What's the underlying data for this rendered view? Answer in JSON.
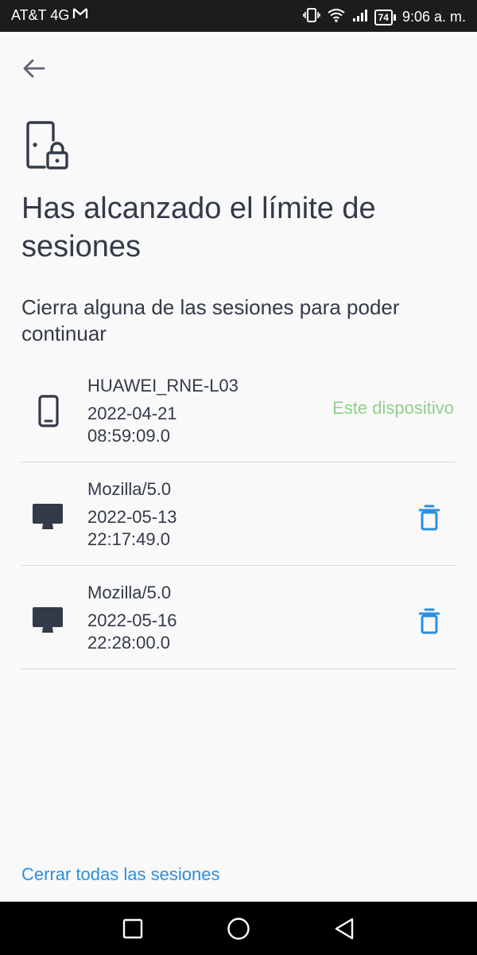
{
  "status_bar": {
    "carrier": "AT&T 4G",
    "battery": "74",
    "time": "9:06 a. m."
  },
  "header": {
    "title": "Has alcanzado el límite de sesiones",
    "subtitle": "Cierra alguna de las sesiones para poder continuar"
  },
  "sessions": [
    {
      "device": "HUAWEI_RNE-L03",
      "date": "2022-04-21",
      "time": "08:59:09.0",
      "type": "phone-icon",
      "current_label": "Este dispositivo"
    },
    {
      "device": "Mozilla/5.0",
      "date": "2022-05-13",
      "time": "22:17:49.0",
      "type": "desktop-icon"
    },
    {
      "device": "Mozilla/5.0",
      "date": "2022-05-16",
      "time": "22:28:00.0",
      "type": "desktop-icon"
    }
  ],
  "footer": {
    "close_all": "Cerrar todas las sesiones"
  },
  "colors": {
    "text": "#333a48",
    "current_device": "#8fd08a",
    "accent": "#2b8fdc"
  }
}
